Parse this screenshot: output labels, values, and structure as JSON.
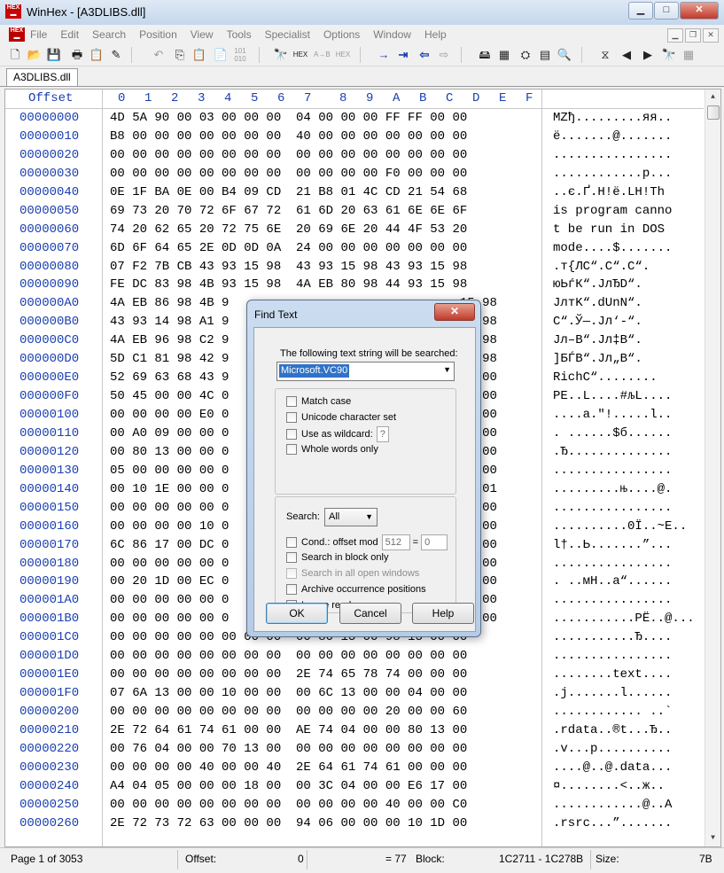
{
  "window": {
    "title": "WinHex - [A3DLIBS.dll]",
    "minimize": "▁",
    "maximize": "□",
    "close": "✕"
  },
  "menu": {
    "items": [
      "File",
      "Edit",
      "Search",
      "Position",
      "View",
      "Tools",
      "Specialist",
      "Options",
      "Window",
      "Help"
    ],
    "mdi": {
      "minimize": "▁",
      "restore": "❐",
      "close": "✕"
    }
  },
  "toolbar": {
    "icons": [
      "new-file-icon",
      "open-file-icon",
      "save-icon",
      "print-icon",
      "properties-icon",
      "edit-icon",
      "undo-icon",
      "copy-icon",
      "paste-icon",
      "paste-special-icon",
      "binary-icon",
      "find-text-icon",
      "find-hex-icon",
      "replace-text-icon",
      "replace-hex-icon",
      "goto-offset-icon",
      "goto-icon",
      "back-icon",
      "forward-icon",
      "disk-icon",
      "ram-icon",
      "tools-icon",
      "calculator-icon",
      "zoom-icon",
      "compare-icon",
      "prev-icon",
      "next-icon",
      "find-next-icon",
      "grid-icon"
    ]
  },
  "tab": {
    "label": "A3DLIBS.dll"
  },
  "editor": {
    "header_offset": "Offset",
    "header_cols": [
      "0",
      "1",
      "2",
      "3",
      "4",
      "5",
      "6",
      "7",
      "8",
      "9",
      "A",
      "B",
      "C",
      "D",
      "E",
      "F"
    ],
    "offsets": [
      "00000000",
      "00000010",
      "00000020",
      "00000030",
      "00000040",
      "00000050",
      "00000060",
      "00000070",
      "00000080",
      "00000090",
      "000000A0",
      "000000B0",
      "000000C0",
      "000000D0",
      "000000E0",
      "000000F0",
      "00000100",
      "00000110",
      "00000120",
      "00000130",
      "00000140",
      "00000150",
      "00000160",
      "00000170",
      "00000180",
      "00000190",
      "000001A0",
      "000001B0",
      "000001C0",
      "000001D0",
      "000001E0",
      "000001F0",
      "00000200",
      "00000210",
      "00000220",
      "00000230",
      "00000240",
      "00000250",
      "00000260"
    ],
    "hex_rows": [
      "4D 5A 90 00 03 00 00 00  04 00 00 00 FF FF 00 00",
      "B8 00 00 00 00 00 00 00  40 00 00 00 00 00 00 00",
      "00 00 00 00 00 00 00 00  00 00 00 00 00 00 00 00",
      "00 00 00 00 00 00 00 00  00 00 00 00 F0 00 00 00",
      "0E 1F BA 0E 00 B4 09 CD  21 B8 01 4C CD 21 54 68",
      "69 73 20 70 72 6F 67 72  61 6D 20 63 61 6E 6E 6F",
      "74 20 62 65 20 72 75 6E  20 69 6E 20 44 4F 53 20",
      "6D 6F 64 65 2E 0D 0D 0A  24 00 00 00 00 00 00 00",
      "07 F2 7B CB 43 93 15 98  43 93 15 98 43 93 15 98",
      "FE DC 83 98 4B 93 15 98  4A EB 80 98 44 93 15 98",
      "4A EB 86 98 4B 9                               15 98",
      "43 93 14 98 A1 9                               15 98",
      "4A EB 96 98 C2 9                               15 98",
      "5D C1 81 98 42 9                               15 98",
      "52 69 63 68 43 9                               00 00",
      "50 45 00 00 4C 0                               00 00",
      "00 00 00 00 E0 0                               13 00",
      "00 A0 09 00 00 0                               00 00",
      "00 80 13 00 00 0                               00 00",
      "05 00 00 00 00 0                               00 00",
      "00 10 1E 00 00 0                               40 01",
      "00 00 00 00 00 0                               00 00",
      "00 00 00 00 10 0                               00 00",
      "6C 86 17 00 DC 0                               00 00",
      "00 00 00 00 00 0                               00 00",
      "00 20 1D 00 EC 0                               00 00",
      "00 00 00 00 00 0                               00 00",
      "00 00 00 00 00 0                               00 00",
      "00 00 00 00 00 00 00 00  00 80 13 00 98 13 00 00",
      "00 00 00 00 00 00 00 00  00 00 00 00 00 00 00 00",
      "00 00 00 00 00 00 00 00  2E 74 65 78 74 00 00 00",
      "07 6A 13 00 00 10 00 00  00 6C 13 00 00 04 00 00",
      "00 00 00 00 00 00 00 00  00 00 00 00 20 00 00 60",
      "2E 72 64 61 74 61 00 00  AE 74 04 00 00 80 13 00",
      "00 76 04 00 00 70 13 00  00 00 00 00 00 00 00 00",
      "00 00 00 00 40 00 00 40  2E 64 61 74 61 00 00 00",
      "A4 04 05 00 00 00 18 00  00 3C 04 00 00 E6 17 00",
      "00 00 00 00 00 00 00 00  00 00 00 00 40 00 00 C0",
      "2E 72 73 72 63 00 00 00  94 06 00 00 00 10 1D 00"
    ],
    "text_rows": [
      "MZђ.........яя..",
      "ё.......@.......",
      "................",
      "............р...",
      "..є.Ґ.Н!ё.LН!Th",
      "is program canno",
      "t be run in DOS ",
      "mode....$.......",
      ".т{ЛС“.С“.С“.",
      "юЬѓК“.JлЂD“.",
      "JлтK“.dUnN“.",
      "С“.Ў—.Jл‘-“.",
      "Jл–В“.Jл‡В“.",
      "]БЃВ“.Jл„В“.",
      "RichС“........",
      "PE..L....#љL....",
      "....а.\"!.....l..",
      ". ......$б......",
      ".Ђ..............",
      "................",
      ".........њ....@.",
      "................",
      "..........0Ї..~E..",
      "l†..Ь.......”...",
      "................",
      ". ..мН..а“......",
      "................",
      "...........РЁ..@...",
      "...........Ђ....",
      "................",
      "........text....",
      ".j.......l......",
      "............ ..`",
      ".rdata..®t...Ђ..",
      ".v...p..........",
      "....@..@.data...",
      "¤........<..ж..",
      "............@..А",
      ".rsrc...”......."
    ]
  },
  "dialog": {
    "title": "Find Text",
    "close": "✕",
    "prompt": "The following text string will be searched:",
    "search_value": "Microsoft.VC90",
    "options": {
      "match_case": "Match case",
      "unicode": "Unicode character set",
      "wildcard": "Use as wildcard:",
      "wildcard_char": "?",
      "whole_words": "Whole words only"
    },
    "search_label": "Search:",
    "search_scope": "All",
    "cond_offset": "Cond.: offset mod",
    "cond_mod": "512",
    "cond_eq": "=",
    "cond_val": "0",
    "block_only": "Search in block only",
    "all_windows": "Search in all open windows",
    "archive": "Archive occurrence positions",
    "ignore_errors": "Ignore read errors",
    "ok": "OK",
    "cancel": "Cancel",
    "help": "Help"
  },
  "status": {
    "page": "Page 1 of 3053",
    "offset_label": "Offset:",
    "offset_value": "0",
    "value": "= 77",
    "block_label": "Block:",
    "block_value": "1C2711 - 1C278B",
    "size_label": "Size:",
    "size_value": "7B"
  }
}
